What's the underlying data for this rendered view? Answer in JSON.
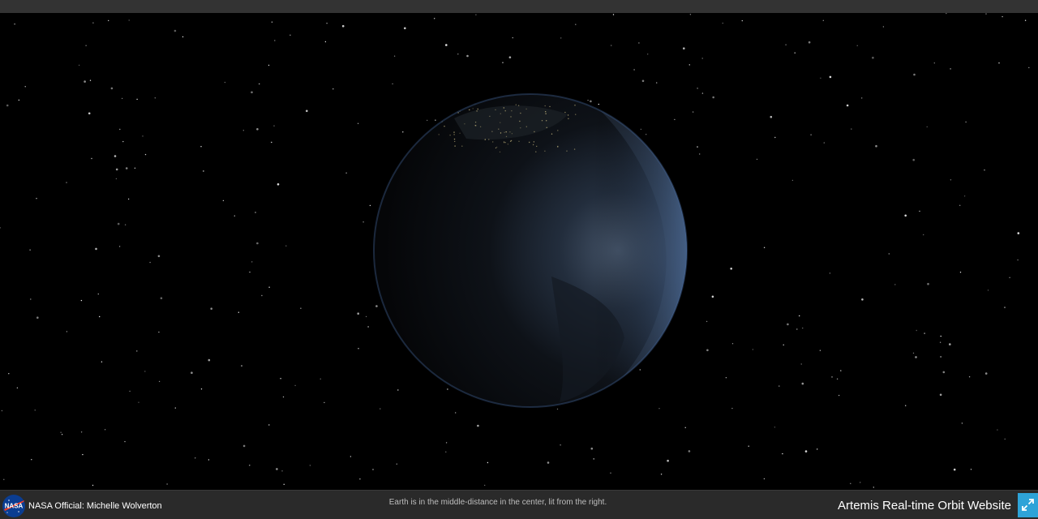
{
  "footer": {
    "official_label": "NASA Official: Michelle Wolverton",
    "caption": "Earth is in the middle-distance in the center, lit from the right.",
    "site_title": "Artemis Real-time Orbit Website",
    "logo_text": "NASA"
  },
  "icons": {
    "logo": "nasa-meatball-logo",
    "expand": "expand-arrows-icon"
  },
  "colors": {
    "background": "#000000",
    "top_bar": "#333333",
    "bottom_bar": "#2a2a2a",
    "accent": "#2ea3d8",
    "nasa_blue": "#0b3d91",
    "nasa_red": "#fc3d21"
  }
}
